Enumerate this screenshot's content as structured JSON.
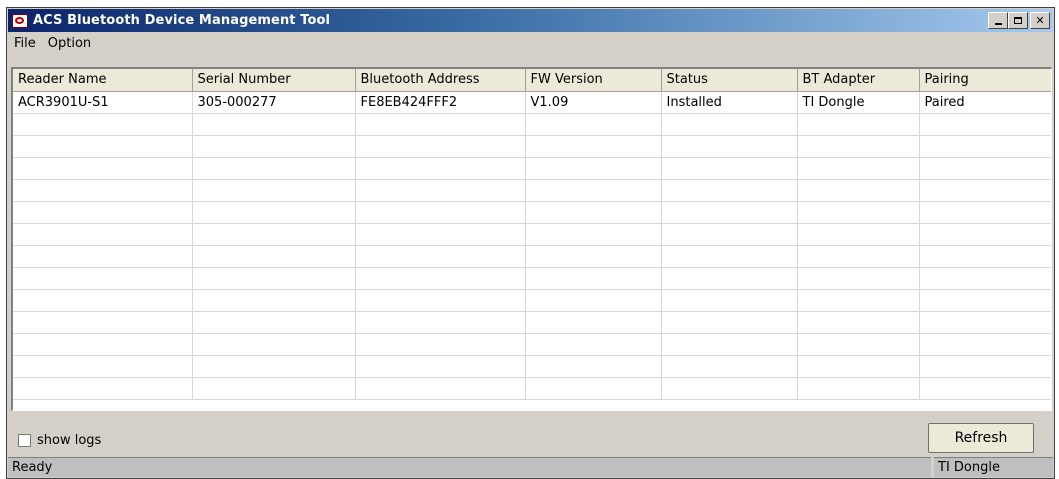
{
  "window": {
    "title": "ACS Bluetooth Device Management Tool",
    "icon": "acs-logo-icon"
  },
  "menu": {
    "items": [
      "File",
      "Option"
    ]
  },
  "table": {
    "columns": [
      "Reader Name",
      "Serial Number",
      "Bluetooth Address",
      "FW Version",
      "Status",
      "BT Adapter",
      "Pairing"
    ],
    "rows": [
      [
        "ACR3901U-S1",
        "305-000277",
        "FE8EB424FFF2",
        "V1.09",
        "Installed",
        "TI Dongle",
        "Paired"
      ]
    ]
  },
  "controls": {
    "show_logs_label": "show logs",
    "show_logs_checked": false,
    "refresh_label": "Refresh"
  },
  "status": {
    "message": "Ready",
    "adapter": "TI Dongle"
  }
}
